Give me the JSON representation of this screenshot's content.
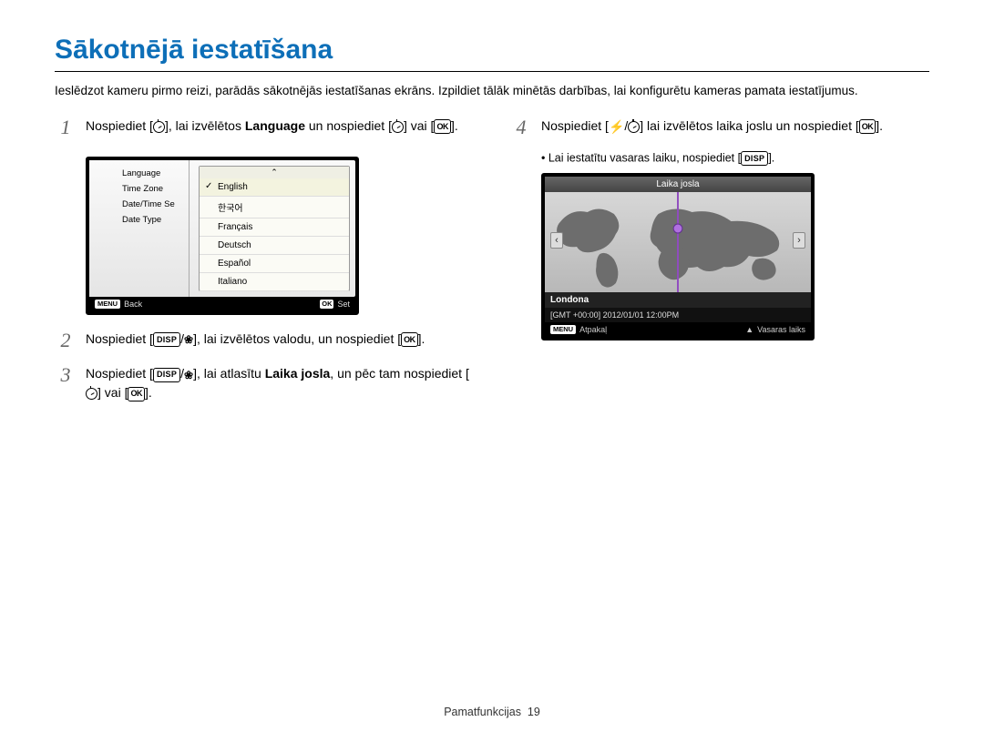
{
  "title": "Sākotnējā iestatīšana",
  "intro": "Ieslēdzot kameru pirmo reizi, parādās sākotnējās iestatīšanas ekrāns. Izpildiet tālāk minētās darbības, lai konfigurētu kameras pamata iestatījumus.",
  "steps": {
    "n1": "1",
    "s1_a": "Nospiediet [",
    "s1_b": "], lai izvēlētos ",
    "s1_lang": "Language",
    "s1_c": " un nospiediet [",
    "s1_d": "] vai [",
    "s1_e": "].",
    "ok": "OK",
    "n2": "2",
    "s2_a": "Nospiediet [",
    "disp": "DISP",
    "s2_b": "], lai izvēlētos valodu, un nospiediet [",
    "s2_c": "].",
    "n3": "3",
    "s3_a": "Nospiediet [",
    "s3_b": "], lai atlasītu ",
    "s3_tj": "Laika josla",
    "s3_c": ", un pēc tam nospiediet [",
    "s3_d": "] vai [",
    "s3_e": "].",
    "n4": "4",
    "s4_a": "Nospiediet [",
    "s4_b": "] lai izvēlētos laika joslu un nospiediet [",
    "s4_c": "].",
    "bullet": "Lai iestatītu vasaras laiku, nospiediet [",
    "bullet_end": "]."
  },
  "langScreen": {
    "menu": {
      "language": "Language",
      "timezone": "Time Zone",
      "datetime": "Date/Time Se",
      "datetype": "Date Type"
    },
    "list": [
      "English",
      "한국어",
      "Français",
      "Deutsch",
      "Español",
      "Italiano"
    ],
    "footBack": "Back",
    "footSet": "Set",
    "menuLabel": "MENU",
    "okLabel": "OK"
  },
  "tzScreen": {
    "title": "Laika josla",
    "city": "Londona",
    "gmt": "[GMT +00:00]   2012/01/01   12:00PM",
    "footBack": "Atpakaļ",
    "footDst": "Vasaras laiks",
    "menuLabel": "MENU"
  },
  "footer": {
    "section": "Pamatfunkcijas",
    "page": "19"
  }
}
